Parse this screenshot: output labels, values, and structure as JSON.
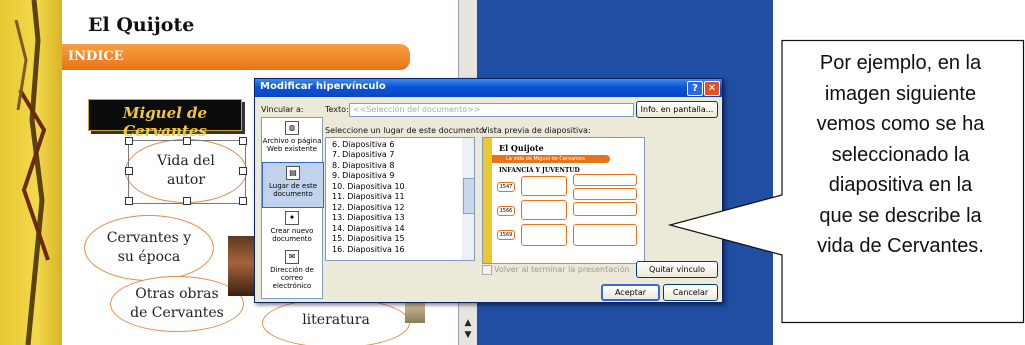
{
  "slide": {
    "title": "El Quijote",
    "indice": "INDICE",
    "author_heading": "Miguel de Cervantes",
    "ovals": [
      "Vida del autor",
      "Cervantes y su época",
      "Otras obras de Cervantes",
      "literatura"
    ]
  },
  "dialog": {
    "title": "Modificar hipervínculo",
    "link_to_label": "Vincular a:",
    "text_label": "Texto:",
    "text_value": "<<Selección del documento>>",
    "screen_info_button": "Info. en pantalla...",
    "place_label": "Seleccione un lugar de este documento:",
    "preview_label": "Vista previa de diapositiva:",
    "link_items": [
      "Archivo o página Web existente",
      "Lugar de este documento",
      "Crear nuevo documento",
      "Dirección de correo electrónico"
    ],
    "places": [
      "6. Diapositiva 6",
      "7. Diapositiva 7",
      "8. Diapositiva 8",
      "9. Diapositiva 9",
      "10. Diapositiva 10",
      "11. Diapositiva 11",
      "12. Diapositiva 12",
      "13. Diapositiva 13",
      "14. Diapositiva 14",
      "15. Diapositiva 15",
      "16. Diapositiva 16"
    ],
    "preview": {
      "title": "El Quijote",
      "banner": "La vida de Miguel de Cervantes",
      "subtitle": "INFANCIA Y JUVENTUD",
      "years": [
        "1547",
        "1566",
        "1569"
      ]
    },
    "show_slide_checkbox": "Volver al terminar la presentación",
    "remove_link_button": "Quitar vínculo",
    "ok_button": "Aceptar",
    "cancel_button": "Cancelar"
  },
  "callout": {
    "lines": [
      "Por ejemplo, en la",
      "imagen siguiente",
      "vemos como se ha",
      "seleccionado la",
      "diapositiva en la",
      "que se describe la",
      "vida de Cervantes."
    ]
  },
  "colors": {
    "orange": "#e8731a",
    "titlebar_blue": "#0a54d8",
    "desktop_blue": "#1f4ea3",
    "cervantes_gold": "#f0c93a"
  }
}
